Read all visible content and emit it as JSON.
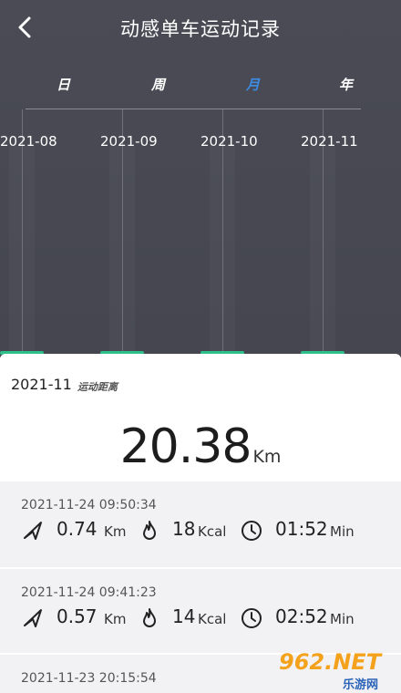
{
  "header": {
    "title": "动感单车运动记录"
  },
  "tabs": [
    "日",
    "周",
    "月",
    "年"
  ],
  "active_tab": "月",
  "months": [
    "2021-08",
    "2021-09",
    "2021-10",
    "2021-11"
  ],
  "summary": {
    "month": "2021-11",
    "label": "运动距离",
    "value": "20.38",
    "unit": "Km"
  },
  "records": [
    {
      "time": "2021-11-24 09:50:34",
      "distance": "0.74",
      "distance_unit": "Km",
      "calories": "18",
      "calories_unit": "Kcal",
      "duration": "01:52",
      "duration_unit": "Min"
    },
    {
      "time": "2021-11-24 09:41:23",
      "distance": "0.57",
      "distance_unit": "Km",
      "calories": "14",
      "calories_unit": "Kcal",
      "duration": "02:52",
      "duration_unit": "Min"
    },
    {
      "time": "2021-11-23 20:15:54"
    }
  ],
  "watermark": {
    "logo": "962.NET",
    "sub": "乐游网"
  },
  "colors": {
    "header_bg": "#47484f",
    "accent": "#3d8be0",
    "bar": "#2fbf8a",
    "list_bg": "#f2f2f4"
  },
  "icons": [
    "back-arrow-icon",
    "distance-arrow-icon",
    "flame-icon",
    "clock-icon"
  ]
}
